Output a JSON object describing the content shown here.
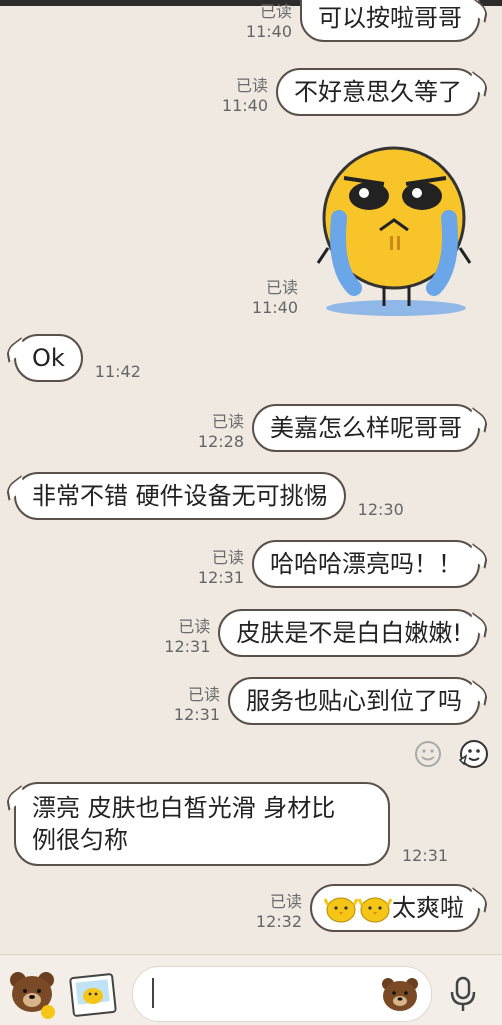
{
  "messages": [
    {
      "dir": "out",
      "read": "已读",
      "time": "11:40",
      "text": "可以按啦哥哥"
    },
    {
      "dir": "out",
      "read": "已读",
      "time": "11:40",
      "text": "不好意思久等了"
    },
    {
      "dir": "out",
      "read": "已读",
      "time": "11:40",
      "sticker": "crying-face-sticker"
    },
    {
      "dir": "in",
      "time": "11:42",
      "text": "Ok"
    },
    {
      "dir": "out",
      "read": "已读",
      "time": "12:28",
      "text": "美嘉怎么样呢哥哥"
    },
    {
      "dir": "in",
      "time": "12:30",
      "text": "非常不错 硬件设备无可挑惕"
    },
    {
      "dir": "out",
      "read": "已读",
      "time": "12:31",
      "text": "哈哈哈漂亮吗！！"
    },
    {
      "dir": "out",
      "read": "已读",
      "time": "12:31",
      "text": "皮肤是不是白白嫩嫩!"
    },
    {
      "dir": "out",
      "read": "已读",
      "time": "12:31",
      "text": "服务也贴心到位了吗"
    },
    {
      "dir": "in",
      "time": "12:31",
      "text_line1": "漂亮 皮肤也白皙光滑 身材比",
      "text_line2": "例很匀称"
    },
    {
      "dir": "out",
      "read": "已读",
      "time": "12:32",
      "emoji_count": 2,
      "text": "太爽啦"
    }
  ],
  "colors": {
    "background": "#efe9e1",
    "bubble_border": "#5a5048",
    "bubble_fill": "#ffffff"
  },
  "icons": [
    "emoji-smile-icon",
    "sticker-icon",
    "brown-bear-sticker-icon",
    "photo-sticker-icon",
    "bear-emoji-icon",
    "microphone-icon"
  ]
}
